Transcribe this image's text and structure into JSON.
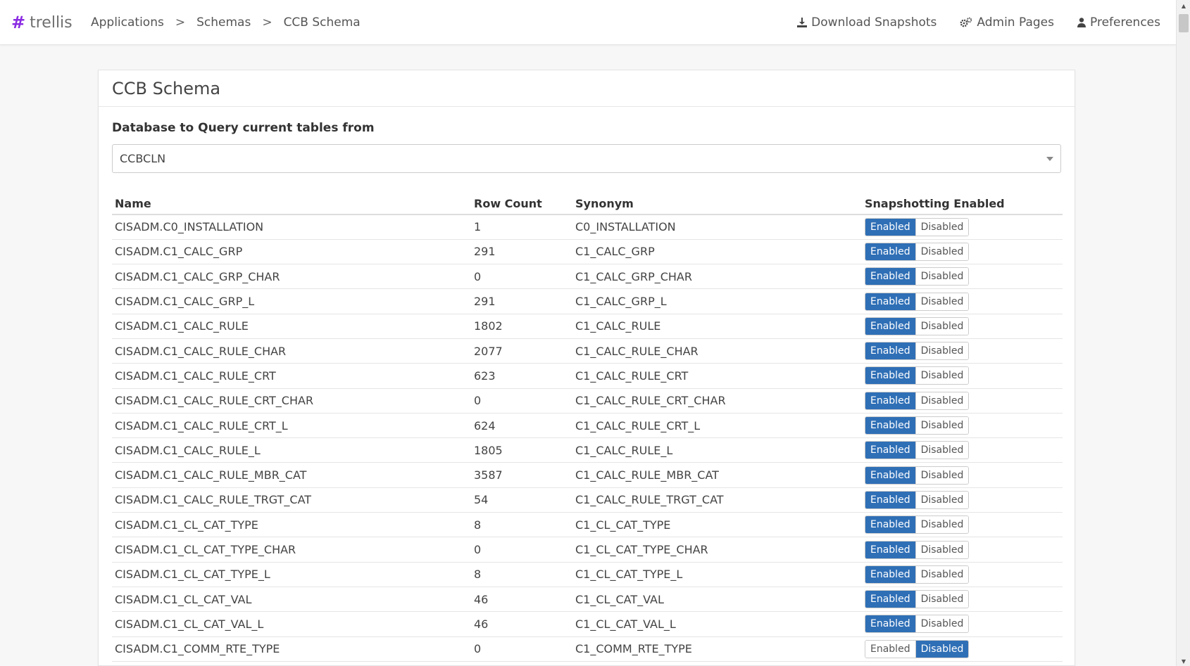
{
  "brand": {
    "hash": "#",
    "name": "trellis"
  },
  "breadcrumb": {
    "items": [
      "Applications",
      "Schemas",
      "CCB Schema"
    ],
    "separator": ">"
  },
  "nav": {
    "download": "Download Snapshots",
    "admin": "Admin Pages",
    "preferences": "Preferences"
  },
  "colors": {
    "accent": "#2f6fb6",
    "brand": "#8a2be2"
  },
  "panel": {
    "title": "CCB Schema",
    "db_label": "Database to Query current tables from",
    "db_value": "CCBCLN"
  },
  "table": {
    "headers": [
      "Name",
      "Row Count",
      "Synonym",
      "Snapshotting Enabled"
    ],
    "toggle_labels": {
      "enabled": "Enabled",
      "disabled": "Disabled"
    },
    "rows": [
      {
        "name": "CISADM.C0_INSTALLATION",
        "count": "1",
        "synonym": "C0_INSTALLATION",
        "enabled": true
      },
      {
        "name": "CISADM.C1_CALC_GRP",
        "count": "291",
        "synonym": "C1_CALC_GRP",
        "enabled": true
      },
      {
        "name": "CISADM.C1_CALC_GRP_CHAR",
        "count": "0",
        "synonym": "C1_CALC_GRP_CHAR",
        "enabled": true
      },
      {
        "name": "CISADM.C1_CALC_GRP_L",
        "count": "291",
        "synonym": "C1_CALC_GRP_L",
        "enabled": true
      },
      {
        "name": "CISADM.C1_CALC_RULE",
        "count": "1802",
        "synonym": "C1_CALC_RULE",
        "enabled": true
      },
      {
        "name": "CISADM.C1_CALC_RULE_CHAR",
        "count": "2077",
        "synonym": "C1_CALC_RULE_CHAR",
        "enabled": true
      },
      {
        "name": "CISADM.C1_CALC_RULE_CRT",
        "count": "623",
        "synonym": "C1_CALC_RULE_CRT",
        "enabled": true
      },
      {
        "name": "CISADM.C1_CALC_RULE_CRT_CHAR",
        "count": "0",
        "synonym": "C1_CALC_RULE_CRT_CHAR",
        "enabled": true
      },
      {
        "name": "CISADM.C1_CALC_RULE_CRT_L",
        "count": "624",
        "synonym": "C1_CALC_RULE_CRT_L",
        "enabled": true
      },
      {
        "name": "CISADM.C1_CALC_RULE_L",
        "count": "1805",
        "synonym": "C1_CALC_RULE_L",
        "enabled": true
      },
      {
        "name": "CISADM.C1_CALC_RULE_MBR_CAT",
        "count": "3587",
        "synonym": "C1_CALC_RULE_MBR_CAT",
        "enabled": true
      },
      {
        "name": "CISADM.C1_CALC_RULE_TRGT_CAT",
        "count": "54",
        "synonym": "C1_CALC_RULE_TRGT_CAT",
        "enabled": true
      },
      {
        "name": "CISADM.C1_CL_CAT_TYPE",
        "count": "8",
        "synonym": "C1_CL_CAT_TYPE",
        "enabled": true
      },
      {
        "name": "CISADM.C1_CL_CAT_TYPE_CHAR",
        "count": "0",
        "synonym": "C1_CL_CAT_TYPE_CHAR",
        "enabled": true
      },
      {
        "name": "CISADM.C1_CL_CAT_TYPE_L",
        "count": "8",
        "synonym": "C1_CL_CAT_TYPE_L",
        "enabled": true
      },
      {
        "name": "CISADM.C1_CL_CAT_VAL",
        "count": "46",
        "synonym": "C1_CL_CAT_VAL",
        "enabled": true
      },
      {
        "name": "CISADM.C1_CL_CAT_VAL_L",
        "count": "46",
        "synonym": "C1_CL_CAT_VAL_L",
        "enabled": true
      },
      {
        "name": "CISADM.C1_COMM_RTE_TYPE",
        "count": "0",
        "synonym": "C1_COMM_RTE_TYPE",
        "enabled": false
      }
    ]
  }
}
